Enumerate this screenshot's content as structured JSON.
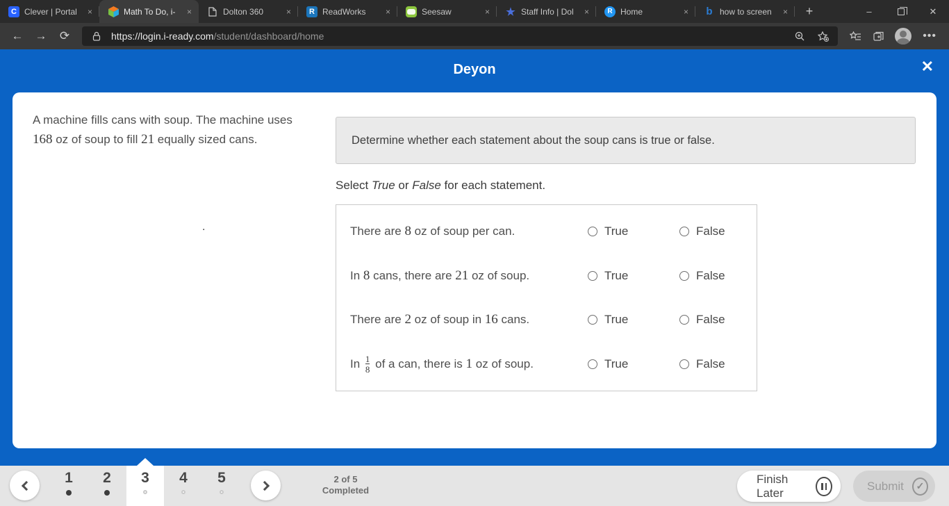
{
  "browser": {
    "tabs": [
      {
        "title": "Clever | Portal"
      },
      {
        "title": "Math To Do, i-"
      },
      {
        "title": "Dolton 360"
      },
      {
        "title": "ReadWorks"
      },
      {
        "title": "Seesaw"
      },
      {
        "title": "Staff Info | Dol"
      },
      {
        "title": "Home"
      },
      {
        "title": "how to screen"
      }
    ],
    "new_tab": "+",
    "url": {
      "host": "https://login.i-ready.com",
      "path": "/student/dashboard/home"
    }
  },
  "icons": {
    "back": "←",
    "forward": "→",
    "refresh": "⟳",
    "tab_close": "×",
    "minimize": "–",
    "close_window": "✕",
    "ellipsis": "•••",
    "header_close": "✕",
    "check": "✓",
    "clever_letter": "C",
    "readworks_letter": "R",
    "home_letter": "R",
    "bing_letter": "b",
    "star": "★"
  },
  "header": {
    "student_name": "Deyon"
  },
  "problem": {
    "s1": "A machine fills cans with soup. The machine uses ",
    "n1": "168",
    "s2": " oz of soup to fill ",
    "n2": "21",
    "s3": " equally sized cans.",
    "stray": "."
  },
  "quiz": {
    "prompt": "Determine whether each statement about the soup cans is true or false.",
    "select_line": {
      "s1": "Select ",
      "i1": "True",
      "s2": " or ",
      "i2": "False",
      "s3": " for each statement."
    },
    "options": {
      "true": "True",
      "false": "False"
    },
    "rows": [
      {
        "s1": "There are ",
        "n1": "8",
        "s2": " oz of soup per can."
      },
      {
        "s1": "In ",
        "n1": "8",
        "s2": " cans, there are ",
        "n2": "21",
        "s3": " oz of soup."
      },
      {
        "s1": "There are ",
        "n1": "2",
        "s2": " oz of soup in ",
        "n2": "16",
        "s3": " cans."
      },
      {
        "s1": "In ",
        "fnum": "1",
        "fden": "8",
        "s2": " of a can, there is ",
        "n2": "1",
        "s3": " oz of soup."
      }
    ]
  },
  "footer": {
    "pages": [
      {
        "label": "1",
        "state": "completed"
      },
      {
        "label": "2",
        "state": "completed"
      },
      {
        "label": "3",
        "state": "current"
      },
      {
        "label": "4",
        "state": "todo"
      },
      {
        "label": "5",
        "state": "todo"
      }
    ],
    "progress_line1": "2 of 5",
    "progress_line2": "Completed",
    "finish_later_label": "Finish Later",
    "submit_label": "Submit"
  },
  "colors": {
    "accent_blue": "#0b63c5",
    "card_bg": "#ffffff",
    "bar_bg": "#e5e5e5"
  }
}
